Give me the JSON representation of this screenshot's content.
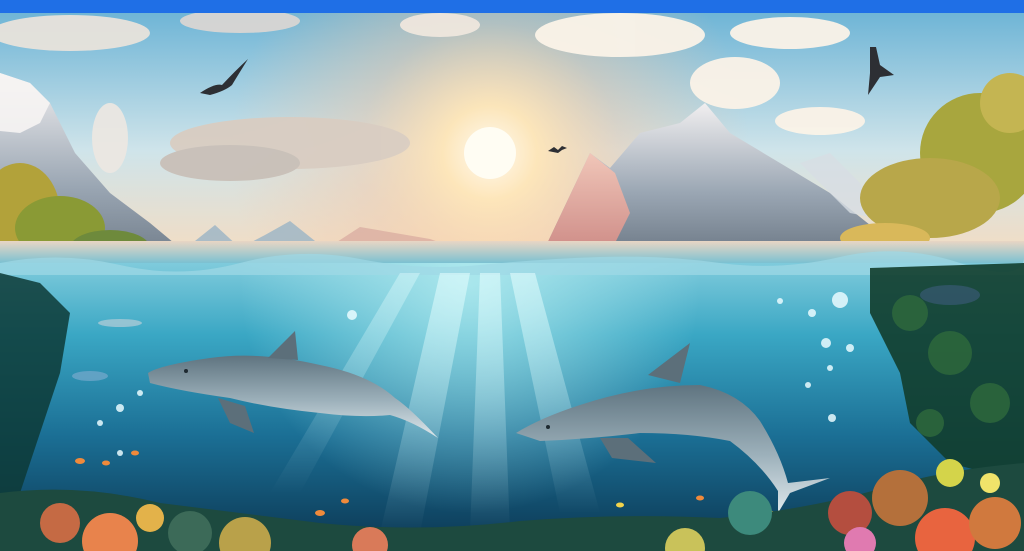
{
  "page": {
    "top_bar_color": "#1f6fe6"
  },
  "scene": {
    "sky_top": "#8fc9e6",
    "sky_glow": "#ffe9c4",
    "sun": "#fff6dc",
    "water_surface": "#8fd3e3",
    "water_deep": "#0b3c5a",
    "dolphin": "#8fa3ad"
  }
}
